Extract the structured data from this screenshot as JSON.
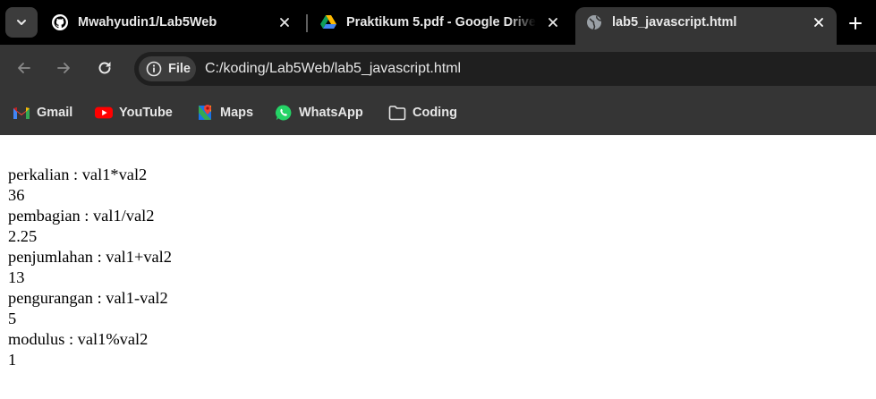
{
  "browser": {
    "tabs": [
      {
        "title": "Mwahyudin1/Lab5Web",
        "favicon": "github-icon",
        "active": false
      },
      {
        "title": "Praktikum 5.pdf - Google Drive",
        "favicon": "google-drive-icon",
        "active": false
      },
      {
        "title": "lab5_javascript.html",
        "favicon": "globe-icon",
        "active": true
      }
    ],
    "address_bar": {
      "chip_label": "File",
      "url": "C:/koding/Lab5Web/lab5_javascript.html"
    },
    "bookmarks": [
      {
        "label": "Gmail",
        "icon": "gmail-icon"
      },
      {
        "label": "YouTube",
        "icon": "youtube-icon"
      },
      {
        "label": "Maps",
        "icon": "maps-icon"
      },
      {
        "label": "WhatsApp",
        "icon": "whatsapp-icon"
      },
      {
        "label": "Coding",
        "icon": "folder-icon"
      }
    ]
  },
  "page": {
    "lines": [
      "perkalian : val1*val2",
      "36",
      "pembagian : val1/val2",
      "2.25",
      "penjumlahan : val1+val2",
      "13",
      "pengurangan : val1-val2",
      "5",
      "modulus : val1%val2",
      "1"
    ]
  }
}
